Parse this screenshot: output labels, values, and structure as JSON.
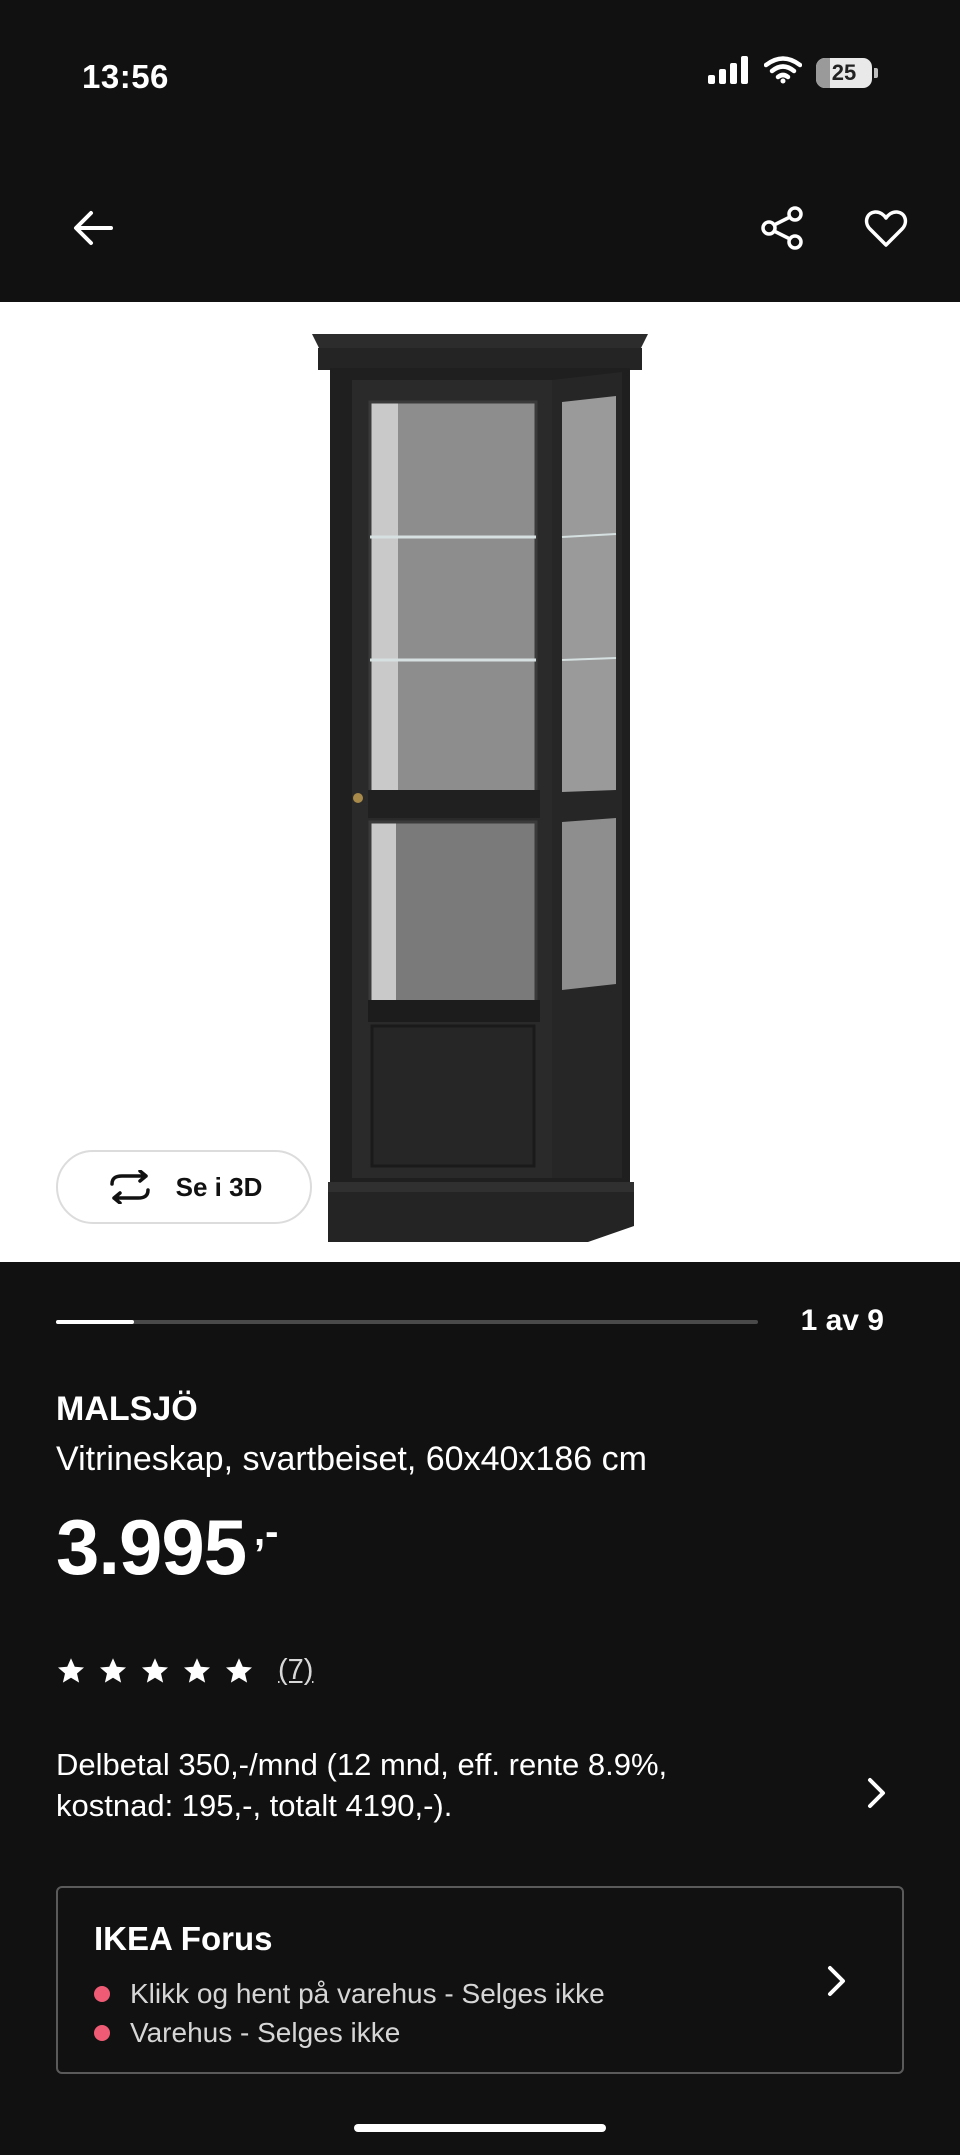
{
  "status_bar": {
    "time": "13:56",
    "battery": "25",
    "battery_level": 0.25
  },
  "product": {
    "name": "MALSJÖ",
    "description": "Vitrineskap, svartbeiset, 60x40x186 cm",
    "price": "3.995",
    "price_suffix": ",-",
    "view_3d_label": "Se i 3D"
  },
  "gallery": {
    "counter": "1 av 9",
    "current": 1,
    "total": 9
  },
  "rating": {
    "stars": 5,
    "count": "(7)"
  },
  "installment": {
    "text": "Delbetal 350,-/mnd (12 mnd, eff. rente 8.9%, kostnad: 195,-, totalt 4190,-)."
  },
  "store": {
    "name": "IKEA Forus",
    "lines": [
      {
        "text": "Klikk og hent på varehus - Selges ikke"
      },
      {
        "text": "Varehus - Selges ikke"
      }
    ]
  },
  "colors": {
    "background": "#111111",
    "status_dot": "#ef5b74"
  }
}
